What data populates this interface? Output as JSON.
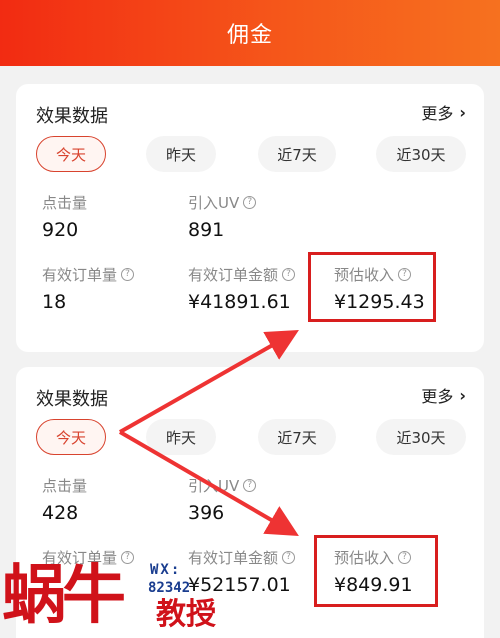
{
  "header": {
    "title": "佣金"
  },
  "cards": [
    {
      "title": "效果数据",
      "more": "更多",
      "tabs": [
        "今天",
        "昨天",
        "近7天",
        "近30天"
      ],
      "active_tab": "今天",
      "metrics": {
        "clicks": {
          "label": "点击量",
          "value": "920"
        },
        "uv": {
          "label": "引入UV",
          "value": "891"
        },
        "orders": {
          "label": "有效订单量",
          "value": "18"
        },
        "amount": {
          "label": "有效订单金额",
          "value": "¥41891.61"
        },
        "income": {
          "label": "预估收入",
          "value": "¥1295.43"
        }
      }
    },
    {
      "title": "效果数据",
      "more": "更多",
      "tabs": [
        "今天",
        "昨天",
        "近7天",
        "近30天"
      ],
      "active_tab": "今天",
      "metrics": {
        "clicks": {
          "label": "点击量",
          "value": "428"
        },
        "uv": {
          "label": "引入UV",
          "value": "396"
        },
        "orders": {
          "label": "有效订单量",
          "value": ""
        },
        "amount": {
          "label": "有效订单金额",
          "value": "¥52157.01"
        },
        "income": {
          "label": "预估收入",
          "value": "¥849.91"
        }
      }
    }
  ],
  "watermark": {
    "brand": "蜗牛",
    "sub": "教授",
    "wx": "WX:",
    "id": "82342"
  },
  "colors": {
    "header": "#f22b12",
    "accent": "#d8432e",
    "annotation": "#d81e1e"
  }
}
